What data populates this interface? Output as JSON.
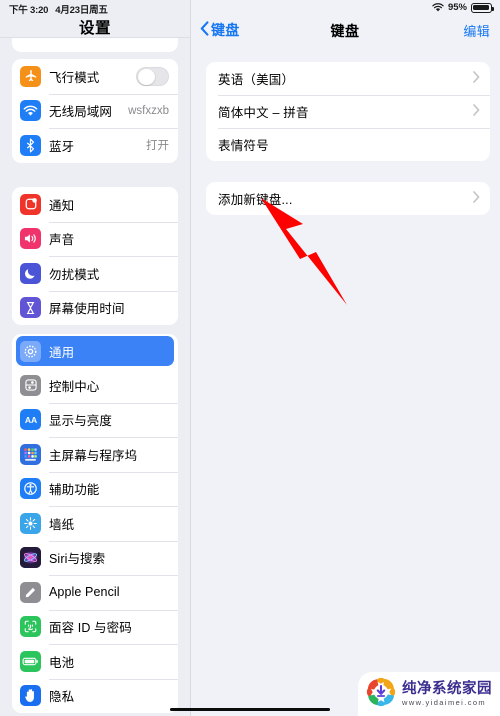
{
  "status_bar": {
    "time": "下午 3:20",
    "date": "4月23日周五",
    "wifi_icon": "wifi-icon",
    "battery_percent": "95%",
    "battery_icon": "battery-icon"
  },
  "sidebar": {
    "title": "设置",
    "groups": [
      {
        "rows": [
          {
            "label": "飞行模式",
            "icon": "airplane-icon",
            "icon_color": "#f59018",
            "control": "toggle",
            "toggle_on": false
          },
          {
            "label": "无线局域网",
            "icon": "wifi-icon",
            "icon_color": "#1f7ef6",
            "value": "wsfxzxb"
          },
          {
            "label": "蓝牙",
            "icon": "bluetooth-icon",
            "icon_color": "#1f7ef6",
            "value": "打开"
          }
        ]
      },
      {
        "rows": [
          {
            "label": "通知",
            "icon": "notification-icon",
            "icon_color": "#f0342a"
          },
          {
            "label": "声音",
            "icon": "sound-icon",
            "icon_color": "#f0336b"
          },
          {
            "label": "勿扰模式",
            "icon": "moon-icon",
            "icon_color": "#4b54d6"
          },
          {
            "label": "屏幕使用时间",
            "icon": "hourglass-icon",
            "icon_color": "#6155d6"
          }
        ]
      },
      {
        "rows": [
          {
            "label": "通用",
            "icon": "gear-icon",
            "icon_color": "#8e8e93",
            "selected": true
          },
          {
            "label": "控制中心",
            "icon": "control-center-icon",
            "icon_color": "#8e8e93"
          },
          {
            "label": "显示与亮度",
            "icon": "display-aa-icon",
            "icon_color": "#1f7ef6"
          },
          {
            "label": "主屏幕与程序坞",
            "icon": "home-screen-icon",
            "icon_color": "#2f6fe0"
          },
          {
            "label": "辅助功能",
            "icon": "accessibility-icon",
            "icon_color": "#1f7ef6"
          },
          {
            "label": "墙纸",
            "icon": "wallpaper-icon",
            "icon_color": "#3aa5e8"
          },
          {
            "label": "Siri与搜索",
            "icon": "siri-icon",
            "icon_color": "#2b1f45"
          },
          {
            "label": "Apple Pencil",
            "icon": "pencil-icon",
            "icon_color": "#8e8e93"
          },
          {
            "label": "面容 ID 与密码",
            "icon": "face-id-icon",
            "icon_color": "#2cc45c"
          },
          {
            "label": "电池",
            "icon": "battery-icon",
            "icon_color": "#2cc45c"
          },
          {
            "label": "隐私",
            "icon": "privacy-hand-icon",
            "icon_color": "#1a6ef0"
          }
        ]
      }
    ]
  },
  "detail": {
    "back_label": "键盘",
    "back_icon": "chevron-left-icon",
    "title": "键盘",
    "edit_label": "编辑",
    "keyboard_card": [
      {
        "label": "英语（美国）",
        "chevron": "chevron-right-icon",
        "has_chevron": true
      },
      {
        "label": "简体中文 – 拼音",
        "chevron": "chevron-right-icon",
        "has_chevron": true
      },
      {
        "label": "表情符号",
        "has_chevron": false
      }
    ],
    "add_card": [
      {
        "label": "添加新键盘...",
        "chevron": "chevron-right-icon",
        "has_chevron": true
      }
    ]
  },
  "annotation": {
    "arrow_color": "#ff0000",
    "arrow_name": "red-pointer-arrow"
  },
  "watermark": {
    "name": "纯净系统家园",
    "url": "www.yidaimei.com",
    "logo_icon": "download-arrow-logo"
  }
}
